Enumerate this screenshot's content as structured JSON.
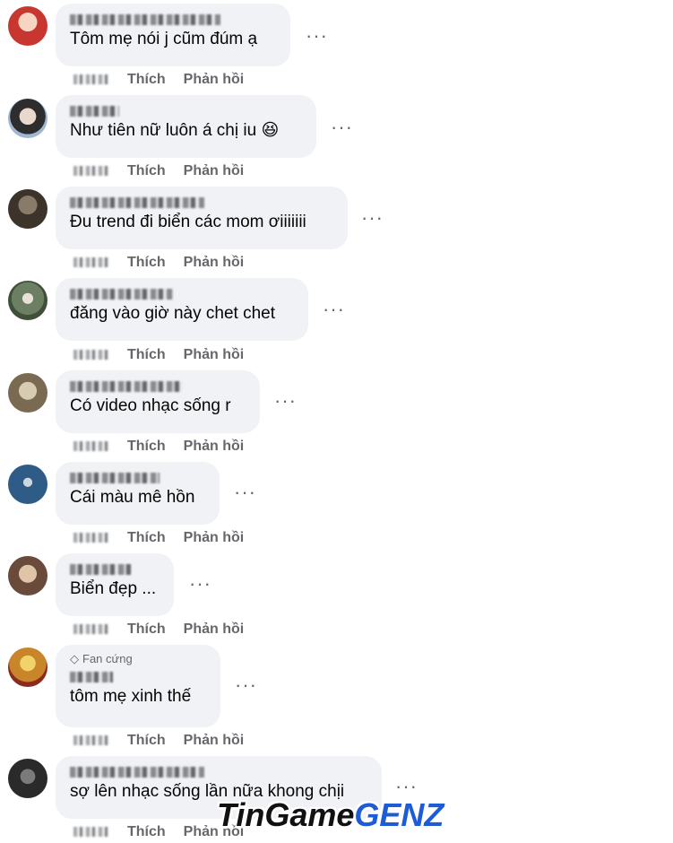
{
  "actions": {
    "like": "Thích",
    "reply": "Phản hồi"
  },
  "more_label": "···",
  "comments": [
    {
      "text": "Tôm mẹ nói j cũm đúm ạ",
      "avatar_color": "#c7372f"
    },
    {
      "text": "Như tiên nữ luôn á chị iu 😆",
      "avatar_color": "#3b3b3b"
    },
    {
      "text": "Đu trend đi biển các mom ơiiiiiii",
      "avatar_color": "#4a4036"
    },
    {
      "text": "đăng vào giờ này chet chet",
      "avatar_color": "#5b6e52"
    },
    {
      "text": "Có video nhạc sống r",
      "avatar_color": "#8c7b63"
    },
    {
      "text": "Cái màu mê hồn",
      "avatar_color": "#2e5c86"
    },
    {
      "text": "Biển đẹp ...",
      "avatar_color": "#6a4a3a"
    },
    {
      "text": "tôm mẹ xinh thế",
      "badge": "Fan cứng",
      "avatar_color": "#c9852a"
    },
    {
      "text": "sợ lên nhạc sống lần nữa khong chịi",
      "avatar_color": "#2a2a2a"
    }
  ],
  "watermark": {
    "part1": "TinGame",
    "part2": "GENZ"
  }
}
